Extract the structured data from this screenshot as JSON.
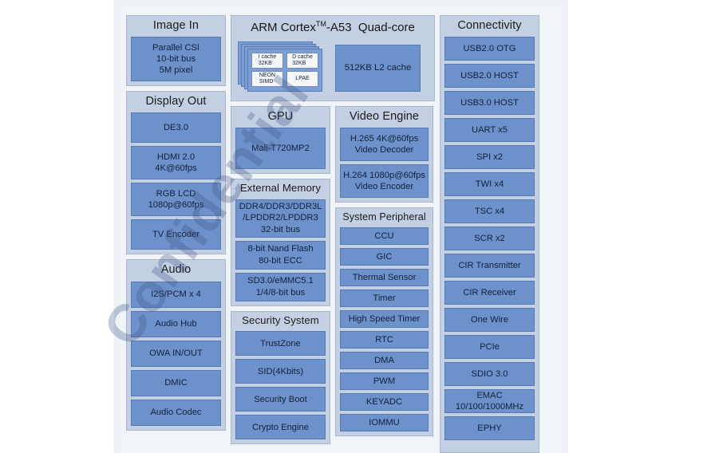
{
  "diagram": {
    "title": "SoC Block Diagram",
    "watermark": "Confidential",
    "colors": {
      "block_fill": "#6d91cb",
      "block_border": "#587ab4",
      "group_fill": "#c3cfe2",
      "group_border": "#a9b7cd",
      "page_bg": "#f1f4f8",
      "core_card_fill": "#7d9ed2",
      "core_cell_fill": "#f4f6fa",
      "watermark_color": "rgba(60,84,128,0.30)"
    }
  },
  "columns": {
    "left": [
      {
        "id": "image-in",
        "header": "Image In",
        "blocks": [
          {
            "label": "Parallel CSI\n10-bit bus\n5M pixel"
          }
        ]
      },
      {
        "id": "display-out",
        "header": "Display Out",
        "blocks": [
          {
            "label": "DE3.0"
          },
          {
            "label": "HDMI 2.0\n4K@60fps"
          },
          {
            "label": "RGB LCD\n1080p@60fps"
          },
          {
            "label": "TV Encoder"
          }
        ]
      },
      {
        "id": "audio",
        "header": "Audio",
        "blocks": [
          {
            "label": "I2S/PCM x 4"
          },
          {
            "label": "Audio Hub"
          },
          {
            "label": "OWA IN/OUT"
          },
          {
            "label": "DMIC"
          },
          {
            "label": "Audio Codec"
          }
        ]
      }
    ],
    "cpu": {
      "id": "arm-cortex-a53",
      "title_pre": "ARM Cortex",
      "title_sup": "TM",
      "title_post": "-A53",
      "title_suffix": "Quad-core",
      "core_cells": [
        {
          "label": "I cache\n32KB"
        },
        {
          "label": "D cache\n32KB"
        },
        {
          "label": "NEON\nSIMD"
        },
        {
          "label": "LPAE"
        }
      ],
      "l2_cache": "512KB L2 cache"
    },
    "mid": [
      {
        "id": "gpu",
        "header": "GPU",
        "blocks": [
          {
            "label": "Mali-T720MP2"
          }
        ]
      },
      {
        "id": "external-memory",
        "header": "External Memory",
        "blocks": [
          {
            "label": "DDR4/DDR3/DDR3L\n/LPDDR2/LPDDR3\n32-bit bus"
          },
          {
            "label": "8-bit Nand Flash\n80-bit ECC"
          },
          {
            "label": "SD3.0/eMMC5.1\n1/4/8-bit bus"
          }
        ]
      },
      {
        "id": "security-system",
        "header": "Security System",
        "blocks": [
          {
            "label": "TrustZone"
          },
          {
            "label": "SID(4Kbits)"
          },
          {
            "label": "Security Boot"
          },
          {
            "label": "Crypto Engine"
          }
        ]
      }
    ],
    "mid2": [
      {
        "id": "video-engine",
        "header": "Video Engine",
        "blocks": [
          {
            "label": "H.265  4K@60fps\nVideo Decoder"
          },
          {
            "label": "H.264 1080p@60fps\nVideo Encoder"
          }
        ]
      },
      {
        "id": "system-peripheral",
        "header": "System Peripheral",
        "blocks": [
          {
            "label": "CCU"
          },
          {
            "label": "GIC"
          },
          {
            "label": "Thermal Sensor"
          },
          {
            "label": "Timer"
          },
          {
            "label": "High Speed Timer"
          },
          {
            "label": "RTC"
          },
          {
            "label": "DMA"
          },
          {
            "label": "PWM"
          },
          {
            "label": "KEYADC"
          },
          {
            "label": "IOMMU"
          }
        ]
      }
    ],
    "right": [
      {
        "id": "connectivity",
        "header": "Connectivity",
        "blocks": [
          {
            "label": "USB2.0 OTG"
          },
          {
            "label": "USB2.0 HOST"
          },
          {
            "label": "USB3.0 HOST"
          },
          {
            "label": "UART x5"
          },
          {
            "label": "SPI x2"
          },
          {
            "label": "TWI x4"
          },
          {
            "label": "TSC x4"
          },
          {
            "label": "SCR x2"
          },
          {
            "label": "CIR Transmitter"
          },
          {
            "label": "CIR Receiver"
          },
          {
            "label": "One Wire"
          },
          {
            "label": "PCIe"
          },
          {
            "label": "SDIO 3.0"
          },
          {
            "label": "EMAC\n10/100/1000MHz"
          },
          {
            "label": "EPHY"
          }
        ]
      }
    ]
  }
}
